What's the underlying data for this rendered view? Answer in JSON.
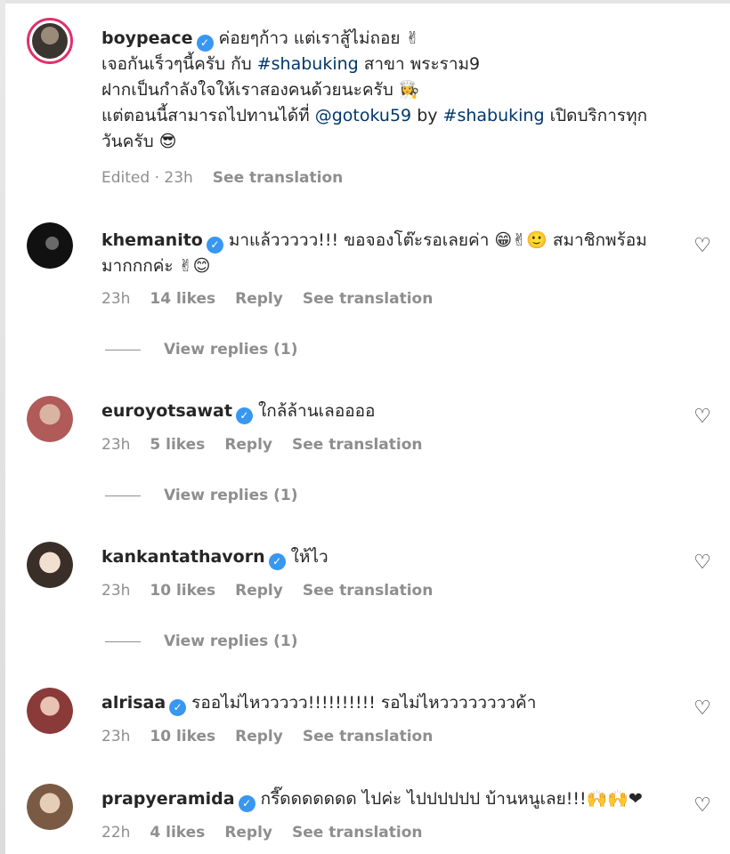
{
  "post": {
    "username": "boypeace",
    "caption_lines": [
      "ค่อยๆก้าว แต่เราสู้ไม่ถอย ✌",
      "เจอกันเร็วๆนี้ครับ กับ #shabuking สาขา พระราม9",
      "ฝากเป็นกำลังใจให้เราสองคนด้วยนะครับ 👩‍🍳",
      "แต่ตอนนี้สามารถไปทานได้ที่ @gotoku59 by #shabuking เปิดบริการทุก",
      "วันครับ 😎"
    ],
    "edited": "Edited · 23h",
    "see_translation": "See translation"
  },
  "comments": [
    {
      "username": "khemanito",
      "lines": [
        "มาแล้ววววว!!! ขอจองโต๊ะรอเลยค่า 😁✌🙂 สมาชิกพร้อม",
        "มากกกค่ะ ✌😊"
      ],
      "time": "23h",
      "likes": "14 likes",
      "reply": "Reply",
      "see_translation": "See translation",
      "view_replies": "View replies (1)",
      "avatar_color": "#111111"
    },
    {
      "username": "euroyotsawat",
      "lines": [
        "ใกล้ล้านเลออออ"
      ],
      "time": "23h",
      "likes": "5 likes",
      "reply": "Reply",
      "see_translation": "See translation",
      "view_replies": "View replies (1)",
      "avatar_color": "#b98a78"
    },
    {
      "username": "kankantathavorn",
      "lines": [
        "ให้ไว"
      ],
      "time": "23h",
      "likes": "10 likes",
      "reply": "Reply",
      "see_translation": "See translation",
      "view_replies": "View replies (1)",
      "avatar_color": "#d8c6b6"
    },
    {
      "username": "alrisaa",
      "lines": [
        "รออไม่ไหววววว!!!!!!!!!! รอไม่ไหววววววววค้า"
      ],
      "time": "23h",
      "likes": "10 likes",
      "reply": "Reply",
      "see_translation": "See translation",
      "avatar_color": "#a0524a"
    },
    {
      "username": "prapyeramida",
      "lines": [
        "กรี๊ดดดดดดด ไปค่ะ ไปปปปปป บ้านหนูเลย!!!🙌🙌❤"
      ],
      "time": "22h",
      "likes": "4 likes",
      "reply": "Reply",
      "see_translation": "See translation",
      "avatar_color": "#c7a68a"
    }
  ],
  "colors": {
    "text": "#262626",
    "muted": "#8e8e8e",
    "link": "#00376b",
    "verified": "#3897f0",
    "ring": "#e1306c"
  }
}
